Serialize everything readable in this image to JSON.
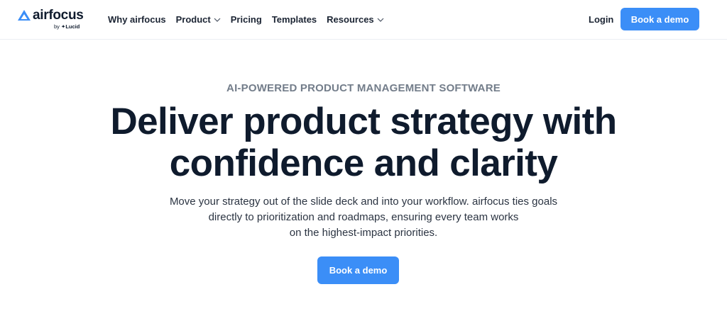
{
  "brand": {
    "name": "airfocus",
    "byline_prefix": "by",
    "byline_company": "Lucid"
  },
  "nav": {
    "items": [
      {
        "label": "Why airfocus",
        "has_dropdown": false
      },
      {
        "label": "Product",
        "has_dropdown": true
      },
      {
        "label": "Pricing",
        "has_dropdown": false
      },
      {
        "label": "Templates",
        "has_dropdown": false
      },
      {
        "label": "Resources",
        "has_dropdown": true
      }
    ],
    "login_label": "Login",
    "cta_label": "Book a demo"
  },
  "hero": {
    "eyebrow": "AI-POWERED PRODUCT MANAGEMENT SOFTWARE",
    "headline_line1": "Deliver product strategy with",
    "headline_line2": "confidence and clarity",
    "subhead_line1": "Move your strategy out of the slide deck and into your workflow. airfocus ties goals",
    "subhead_line2": "directly to prioritization and roadmaps, ensuring every team works",
    "subhead_line3": "on the highest-impact priorities.",
    "cta_label": "Book a demo"
  },
  "colors": {
    "accent": "#3b8ef7",
    "text_dark": "#0f1b2d",
    "eyebrow_gray": "#737d8a"
  }
}
